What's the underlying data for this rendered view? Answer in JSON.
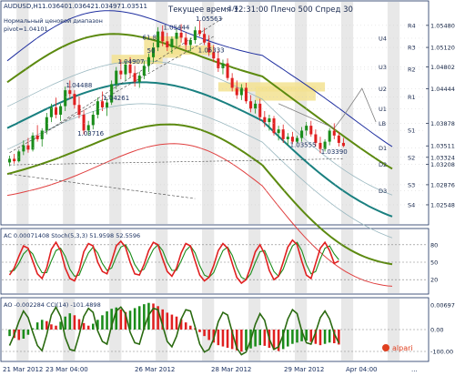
{
  "header": {
    "symbol": "AUDUSD,H1",
    "ohlc": [
      "1.03640",
      "1.03642",
      "1.03497",
      "1.03511"
    ],
    "indicator_name": "Нормальный ценовой диапазон",
    "indicator_params": "pivot=1.04101",
    "status": "Текущее время 12:31:00 Плечо 500 Спред 30"
  },
  "colors": {
    "bull": "#1a8c1a",
    "bear": "#e02020",
    "line_olive": "#5c8a10",
    "line_teal": "#1a8080",
    "line_red": "#e04040",
    "line_navy": "#2030a0",
    "zone": "#f3e290",
    "stripe": "#e8e8e8",
    "axis": "#102040"
  },
  "chart_data": [
    {
      "type": "candlestick",
      "panel": "price",
      "y_axis_labels": [
        "1.05480",
        "1.05120",
        "1.04802",
        "1.04444",
        "1.03878",
        "1.03511",
        "1.03324",
        "1.03208",
        "1.02876",
        "1.02548"
      ],
      "ylim": [
        1.0225,
        1.0585
      ],
      "price_levels": [
        {
          "name": "R4",
          "value": 1.0548
        },
        {
          "name": "R3",
          "value": 1.0512
        },
        {
          "name": "U4",
          "value": 1.0527
        },
        {
          "name": "U3",
          "value": 1.04802
        },
        {
          "name": "R2",
          "value": 1.04764
        },
        {
          "name": "U2",
          "value": 1.04444
        },
        {
          "name": "R1",
          "value": 1.04314
        },
        {
          "name": "U1",
          "value": 1.0412
        },
        {
          "name": "LB",
          "value": 1.03878
        },
        {
          "name": "S1",
          "value": 1.03765
        },
        {
          "name": "D1",
          "value": 1.0348
        },
        {
          "name": "S2",
          "value": 1.03324
        },
        {
          "name": "D2",
          "value": 1.03208
        },
        {
          "name": "S3",
          "value": 1.02876
        },
        {
          "name": "D3",
          "value": 1.02776
        },
        {
          "name": "S4",
          "value": 1.02548
        }
      ],
      "annotations": [
        {
          "text": "1.05563",
          "x": 42.5,
          "y": 1.0555
        },
        {
          "text": "1.05444",
          "x": 35.5,
          "y": 1.0541
        },
        {
          "text": "1.05333",
          "x": 43,
          "y": 1.0504
        },
        {
          "text": "1.04907",
          "x": 25.7,
          "y": 1.0485
        },
        {
          "text": "1.04488",
          "x": 14.5,
          "y": 1.0447
        },
        {
          "text": "1.04261",
          "x": 22.5,
          "y": 1.0426
        },
        {
          "text": "1.03716",
          "x": 17,
          "y": 1.0368
        },
        {
          "text": "1.03555",
          "x": 62.8,
          "y": 1.0349
        },
        {
          "text": "1.03390",
          "x": 69.5,
          "y": 1.0338
        },
        {
          "text": "61.8",
          "x": 31,
          "y": 1.0525
        },
        {
          "text": "50",
          "x": 32,
          "y": 1.0503
        },
        {
          "text": "-1/4",
          "x": 49,
          "y": 1.0572
        }
      ],
      "candles": [
        [
          1.0324,
          1.0335,
          1.0318,
          1.033
        ],
        [
          1.033,
          1.0338,
          1.0322,
          1.0326
        ],
        [
          1.0326,
          1.0345,
          1.0324,
          1.0342
        ],
        [
          1.0342,
          1.036,
          1.0336,
          1.0352
        ],
        [
          1.0352,
          1.0364,
          1.034,
          1.0345
        ],
        [
          1.0345,
          1.0373,
          1.0342,
          1.0368
        ],
        [
          1.0368,
          1.0385,
          1.0358,
          1.0362
        ],
        [
          1.0362,
          1.038,
          1.035,
          1.0376
        ],
        [
          1.0376,
          1.0405,
          1.037,
          1.0398
        ],
        [
          1.0398,
          1.042,
          1.039,
          1.0414
        ],
        [
          1.0414,
          1.043,
          1.0396,
          1.0402
        ],
        [
          1.0402,
          1.042,
          1.0392,
          1.0416
        ],
        [
          1.0416,
          1.0448,
          1.0408,
          1.0442
        ],
        [
          1.0442,
          1.0458,
          1.0428,
          1.0436
        ],
        [
          1.0436,
          1.0442,
          1.0412,
          1.0418
        ],
        [
          1.0418,
          1.0432,
          1.0396,
          1.0402
        ],
        [
          1.0402,
          1.041,
          1.037,
          1.0376
        ],
        [
          1.0376,
          1.0392,
          1.0368,
          1.0385
        ],
        [
          1.0385,
          1.0408,
          1.0378,
          1.0402
        ],
        [
          1.0402,
          1.043,
          1.0396,
          1.0424
        ],
        [
          1.0424,
          1.044,
          1.0408,
          1.0414
        ],
        [
          1.0414,
          1.0428,
          1.04,
          1.0422
        ],
        [
          1.0422,
          1.0458,
          1.0418,
          1.0452
        ],
        [
          1.0452,
          1.048,
          1.0444,
          1.0474
        ],
        [
          1.0474,
          1.0492,
          1.046,
          1.0468
        ],
        [
          1.0468,
          1.049,
          1.0458,
          1.0484
        ],
        [
          1.0484,
          1.0496,
          1.0462,
          1.047
        ],
        [
          1.047,
          1.0482,
          1.0448,
          1.0456
        ],
        [
          1.0456,
          1.0472,
          1.0446,
          1.0466
        ],
        [
          1.0466,
          1.049,
          1.046,
          1.0482
        ],
        [
          1.0482,
          1.0502,
          1.0472,
          1.0496
        ],
        [
          1.0496,
          1.052,
          1.0488,
          1.0512
        ],
        [
          1.0512,
          1.0545,
          1.0506,
          1.0538
        ],
        [
          1.0538,
          1.0548,
          1.0514,
          1.0522
        ],
        [
          1.0522,
          1.0536,
          1.0506,
          1.0512
        ],
        [
          1.0512,
          1.053,
          1.0502,
          1.0526
        ],
        [
          1.0526,
          1.0542,
          1.0514,
          1.0536
        ],
        [
          1.0536,
          1.055,
          1.052,
          1.0528
        ],
        [
          1.0528,
          1.0536,
          1.0508,
          1.0516
        ],
        [
          1.0516,
          1.0528,
          1.0506,
          1.0524
        ],
        [
          1.0524,
          1.0546,
          1.0518,
          1.054
        ],
        [
          1.054,
          1.0556,
          1.053,
          1.0534
        ],
        [
          1.0534,
          1.0544,
          1.0516,
          1.052
        ],
        [
          1.052,
          1.0532,
          1.0498,
          1.0504
        ],
        [
          1.0504,
          1.0516,
          1.0488,
          1.0494
        ],
        [
          1.0494,
          1.0506,
          1.0472,
          1.0478
        ],
        [
          1.0478,
          1.0492,
          1.0468,
          1.0486
        ],
        [
          1.0486,
          1.0494,
          1.0458,
          1.0462
        ],
        [
          1.0462,
          1.047,
          1.044,
          1.0446
        ],
        [
          1.0446,
          1.0458,
          1.0428,
          1.0434
        ],
        [
          1.0434,
          1.0452,
          1.0426,
          1.0446
        ],
        [
          1.0446,
          1.0454,
          1.042,
          1.0424
        ],
        [
          1.0424,
          1.0434,
          1.0406,
          1.0412
        ],
        [
          1.0412,
          1.0426,
          1.0404,
          1.042
        ],
        [
          1.042,
          1.0428,
          1.0392,
          1.0398
        ],
        [
          1.0398,
          1.0408,
          1.0382,
          1.039
        ],
        [
          1.039,
          1.0402,
          1.0376,
          1.0396
        ],
        [
          1.0396,
          1.04,
          1.0368,
          1.0372
        ],
        [
          1.0372,
          1.0384,
          1.036,
          1.0378
        ],
        [
          1.0378,
          1.0386,
          1.0356,
          1.0362
        ],
        [
          1.0362,
          1.0372,
          1.0352,
          1.0366
        ],
        [
          1.0366,
          1.0374,
          1.0354,
          1.0358
        ],
        [
          1.0358,
          1.0368,
          1.0355,
          1.0364
        ],
        [
          1.0364,
          1.0382,
          1.0358,
          1.0376
        ],
        [
          1.0376,
          1.039,
          1.0368,
          1.0384
        ],
        [
          1.0384,
          1.0392,
          1.0366,
          1.037
        ],
        [
          1.037,
          1.0378,
          1.035,
          1.0356
        ],
        [
          1.0356,
          1.0366,
          1.0339,
          1.0346
        ],
        [
          1.0346,
          1.0362,
          1.0342,
          1.0358
        ],
        [
          1.0358,
          1.038,
          1.0352,
          1.0376
        ],
        [
          1.0376,
          1.0388,
          1.0362,
          1.0368
        ],
        [
          1.0368,
          1.0374,
          1.035,
          1.0356
        ],
        [
          1.0356,
          1.0364,
          1.0349,
          1.0351
        ]
      ]
    },
    {
      "type": "line",
      "panel": "stochastic",
      "title": "AC 0.00071408  Stoch(5,3,3) 51.9598 52.5596",
      "y_axis_labels": [
        "80",
        "50",
        "20"
      ],
      "ylim": [
        0,
        100
      ],
      "series": [
        {
          "name": "Stoch(5,3,3) main",
          "color": "#e02020",
          "values": [
            28,
            40,
            60,
            78,
            74,
            52,
            30,
            22,
            40,
            72,
            84,
            70,
            40,
            22,
            18,
            36,
            68,
            82,
            78,
            50,
            34,
            30,
            52,
            78,
            86,
            76,
            50,
            30,
            28,
            46,
            70,
            84,
            80,
            56,
            34,
            26,
            40,
            66,
            82,
            78,
            52,
            28,
            18,
            24,
            44,
            70,
            82,
            74,
            48,
            24,
            14,
            20,
            42,
            68,
            80,
            64,
            36,
            20,
            26,
            50,
            76,
            88,
            80,
            52,
            28,
            22,
            48,
            74,
            84,
            70,
            48,
            52
          ]
        },
        {
          "name": "Stoch(5,3,3) signal",
          "color": "#1a8c1a",
          "values": [
            34,
            36,
            48,
            64,
            72,
            64,
            46,
            32,
            32,
            52,
            70,
            74,
            60,
            38,
            26,
            28,
            48,
            66,
            76,
            66,
            48,
            36,
            40,
            60,
            76,
            80,
            66,
            46,
            34,
            38,
            56,
            72,
            80,
            70,
            50,
            36,
            36,
            52,
            70,
            78,
            66,
            44,
            28,
            24,
            32,
            52,
            70,
            76,
            62,
            40,
            24,
            20,
            30,
            50,
            68,
            70,
            52,
            34,
            26,
            38,
            60,
            78,
            84,
            70,
            46,
            30,
            34,
            56,
            74,
            78,
            64,
            54
          ]
        }
      ]
    },
    {
      "type": "bar",
      "panel": "awesome-oscillator",
      "title": "AO -0.002284  CCI(14) -101.4898",
      "y_axis_labels": [
        "0.006971",
        "0.00",
        "-100.00"
      ],
      "zero_level": 0,
      "values": [
        -1,
        -1.3,
        -1.6,
        -1.4,
        -0.8,
        0.2,
        1.1,
        1.5,
        1.3,
        0.8,
        0.6,
        1.2,
        2.0,
        2.5,
        2.2,
        1.6,
        1.0,
        0.6,
        0.9,
        1.5,
        2.2,
        2.8,
        3.2,
        3.4,
        3.1,
        2.7,
        2.9,
        3.3,
        3.6,
        3.9,
        4.1,
        4.0,
        3.6,
        3.1,
        2.6,
        2.3,
        2.0,
        1.6,
        1.1,
        0.6,
        0.2,
        -0.4,
        -1.0,
        -1.6,
        -2.0,
        -2.4,
        -2.6,
        -2.8,
        -3.0,
        -3.2,
        -3.4,
        -3.2,
        -2.9,
        -2.6,
        -2.4,
        -2.5,
        -2.8,
        -3.1,
        -3.3,
        -3.0,
        -2.6,
        -2.2,
        -2.0,
        -1.8,
        -1.7,
        -1.9,
        -2.2,
        -2.4,
        -2.2,
        -2.0,
        -2.1,
        -2.3
      ],
      "series": [
        {
          "name": "CCI(14)",
          "color": "#2a6a10",
          "values": [
            -120,
            -40,
            60,
            140,
            90,
            -20,
            -120,
            -160,
            -40,
            110,
            170,
            100,
            -60,
            -150,
            -160,
            -40,
            100,
            160,
            130,
            -10,
            -90,
            -110,
            30,
            140,
            170,
            120,
            -20,
            -100,
            -110,
            10,
            110,
            160,
            150,
            30,
            -90,
            -130,
            -50,
            80,
            150,
            140,
            20,
            -110,
            -170,
            -150,
            -70,
            60,
            130,
            110,
            -20,
            -140,
            -190,
            -170,
            -80,
            40,
            120,
            70,
            -70,
            -150,
            -130,
            -40,
            80,
            150,
            120,
            -10,
            -100,
            -110,
            -20,
            90,
            140,
            80,
            -30,
            -101
          ]
        }
      ]
    }
  ],
  "time_axis": [
    "21 Mar 2012",
    "23 Mar 04:00",
    "26 Mar 2012",
    "28 Mar 2012",
    "29 Mar 2012",
    "Apr 04:00",
    "..."
  ],
  "logo": {
    "text": "alpari"
  }
}
